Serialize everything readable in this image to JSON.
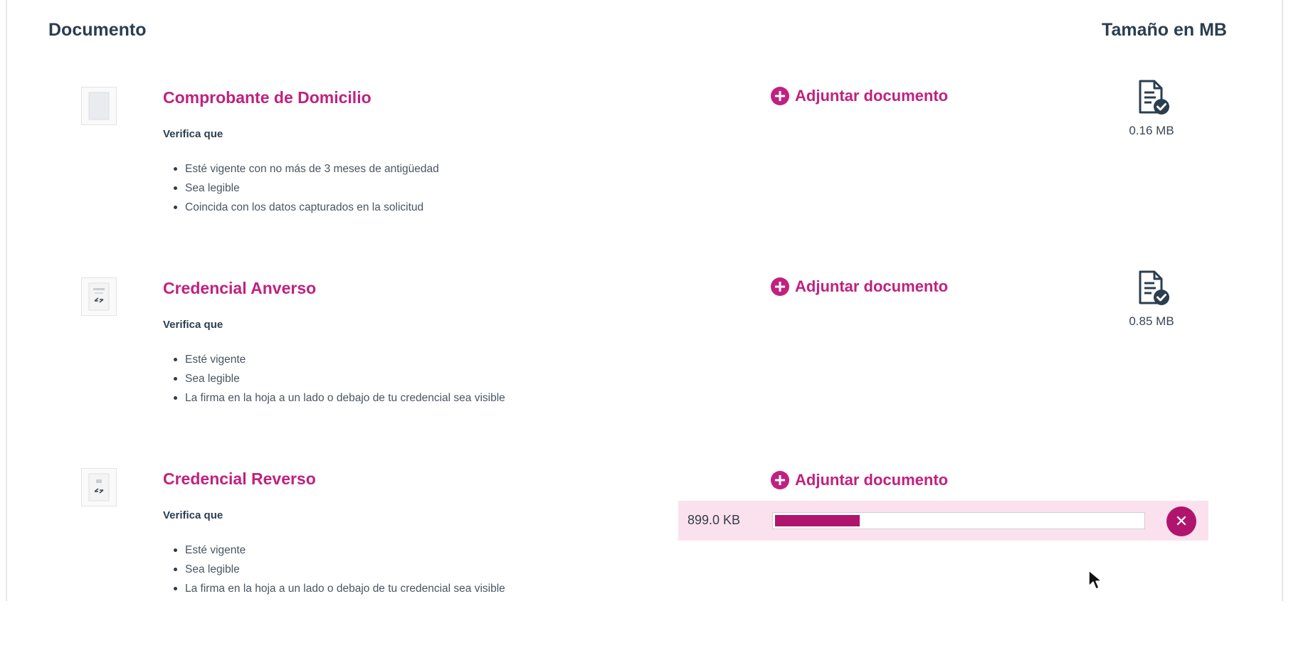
{
  "header": {
    "document_col": "Documento",
    "size_col": "Tamaño en MB"
  },
  "documents": [
    {
      "title": "Comprobante de Domicilio",
      "verify_label": "Verifica que",
      "criteria": [
        "Esté vigente con no más de 3 meses de antigüedad",
        "Sea legible",
        "Coincida con los datos capturados en la solicitud"
      ],
      "attach_label": "Adjuntar documento",
      "file_size": "0.16 MB"
    },
    {
      "title": "Credencial Anverso",
      "verify_label": "Verifica que",
      "criteria": [
        "Esté vigente",
        "Sea legible",
        "La firma en la hoja a un lado o debajo de tu credencial sea visible"
      ],
      "attach_label": "Adjuntar documento",
      "file_size": "0.85 MB"
    },
    {
      "title": "Credencial Reverso",
      "verify_label": "Verifica que",
      "criteria": [
        "Esté vigente",
        "Sea legible",
        "La firma en la hoja a un lado o debajo de tu credencial sea visible"
      ],
      "attach_label": "Adjuntar documento"
    }
  ],
  "upload": {
    "size_label": "899.0 KB",
    "progress": 0.23,
    "cancel_icon": "close-icon"
  },
  "colors": {
    "accent": "#c0217f",
    "progress": "#b0156d",
    "upload_bg": "#fbe1ee",
    "heading": "#2b3e50"
  }
}
